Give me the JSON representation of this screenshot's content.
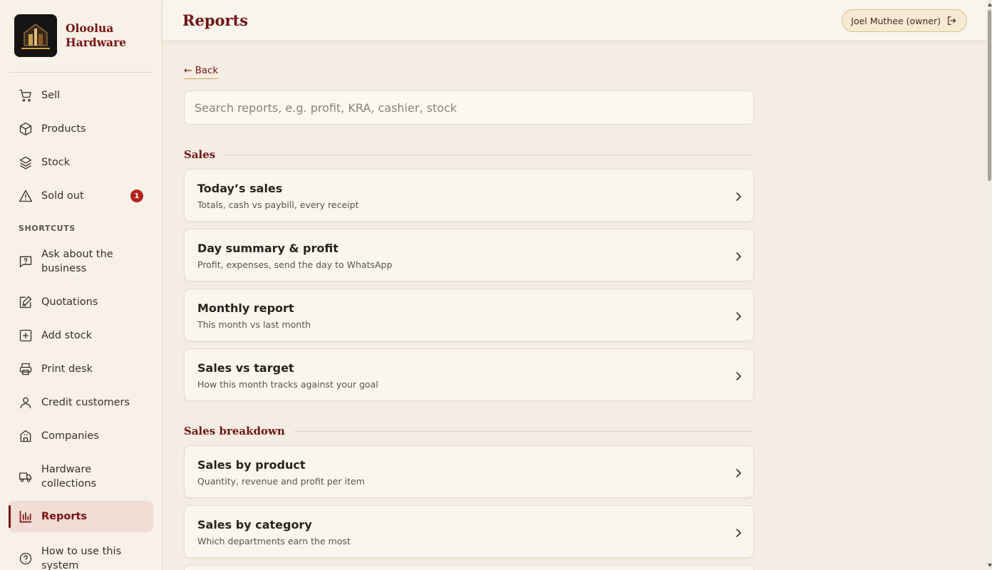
{
  "brand": {
    "name_line1": "Oloolua",
    "name_line2": "Hardware"
  },
  "sidebar": {
    "items": [
      {
        "label": "Sell"
      },
      {
        "label": "Products"
      },
      {
        "label": "Stock"
      },
      {
        "label": "Sold out",
        "badge": "1"
      }
    ],
    "shortcuts_label": "SHORTCUTS",
    "shortcuts": [
      {
        "label": "Ask about the business"
      },
      {
        "label": "Quotations"
      },
      {
        "label": "Add stock"
      },
      {
        "label": "Print desk"
      },
      {
        "label": "Credit customers"
      },
      {
        "label": "Companies"
      },
      {
        "label": "Hardware collections"
      },
      {
        "label": "Reports",
        "active": true
      },
      {
        "label": "How to use this system"
      }
    ]
  },
  "header": {
    "title": "Reports",
    "user": "Joel Muthee (owner)"
  },
  "main": {
    "back_label": "← Back",
    "search_placeholder": "Search reports, e.g. profit, KRA, cashier, stock",
    "sections": [
      {
        "title": "Sales",
        "cards": [
          {
            "title": "Today’s sales",
            "subtitle": "Totals, cash vs paybill, every receipt"
          },
          {
            "title": "Day summary & profit",
            "subtitle": "Profit, expenses, send the day to WhatsApp"
          },
          {
            "title": "Monthly report",
            "subtitle": "This month vs last month"
          },
          {
            "title": "Sales vs target",
            "subtitle": "How this month tracks against your goal"
          }
        ]
      },
      {
        "title": "Sales breakdown",
        "cards": [
          {
            "title": "Sales by product",
            "subtitle": "Quantity, revenue and profit per item"
          },
          {
            "title": "Sales by category",
            "subtitle": "Which departments earn the most"
          }
        ]
      }
    ]
  },
  "colors": {
    "accent": "#7a1212",
    "background": "#f5ede3",
    "badge": "#b3261e"
  }
}
